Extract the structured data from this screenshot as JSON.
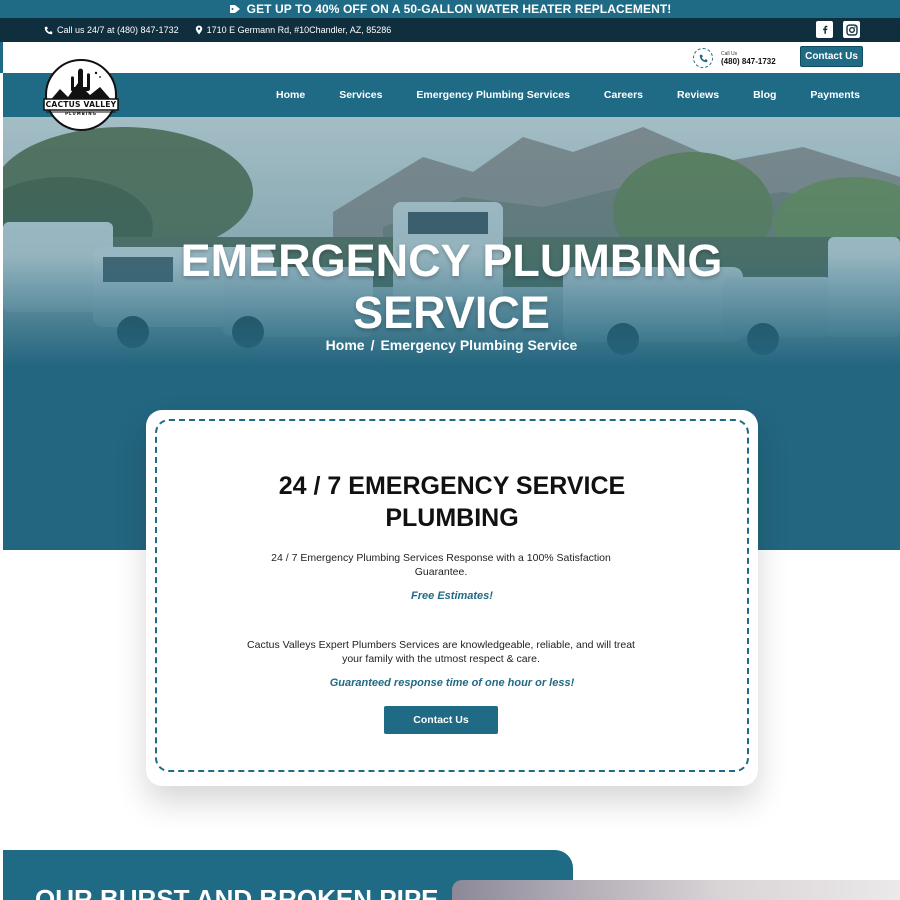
{
  "promo": {
    "text": "GET UP TO 40% OFF ON A 50-GALLON WATER HEATER REPLACEMENT!",
    "icon": "tag-icon"
  },
  "topbar": {
    "phone_text": "Call us 24/7 at (480) 847-1732",
    "address_text": "1710 E Germann Rd, #10Chandler, AZ, 85286",
    "social": [
      "facebook-icon",
      "instagram-icon"
    ]
  },
  "utility": {
    "call_label": "Call Us",
    "call_number": "(480) 847-1732",
    "contact_label": "Contact Us"
  },
  "logo": {
    "line1": "CACTUS VALLEY",
    "line2": "PLUMBING"
  },
  "nav": {
    "items": [
      "Home",
      "Services",
      "Emergency Plumbing Services",
      "Careers",
      "Reviews",
      "Blog",
      "Payments"
    ]
  },
  "hero": {
    "title_line1": "EMERGENCY PLUMBING",
    "title_line2": "SERVICE",
    "breadcrumb": {
      "home": "Home",
      "separator": "/",
      "current": "Emergency Plumbing Service"
    }
  },
  "card": {
    "title_line1": "24 / 7 EMERGENCY SERVICE",
    "title_line2": "PLUMBING",
    "para1": "24 / 7 Emergency Plumbing Services Response with a 100% Satisfaction Guarantee.",
    "highlight1": "Free Estimates!",
    "para2": "Cactus Valleys Expert Plumbers Services are knowledgeable, reliable, and will treat your family with the utmost respect & care.",
    "highlight2": "Guaranteed response time of one hour or less!",
    "button_label": "Contact Us"
  },
  "section2": {
    "title": "OUR BURST AND BROKEN PIPE"
  },
  "colors": {
    "brand": "#1f6a85",
    "dark": "#0f2e3e",
    "white": "#ffffff"
  }
}
